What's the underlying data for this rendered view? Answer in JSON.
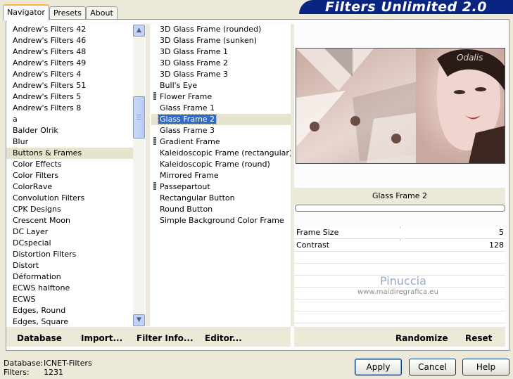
{
  "tabs": [
    "Navigator",
    "Presets",
    "About"
  ],
  "banner": "Filters Unlimited 2.0",
  "categories": [
    "Andrew's Filters 42",
    "Andrew's Filters 46",
    "Andrew's Filters 48",
    "Andrew's Filters 49",
    "Andrew's Filters 4",
    "Andrew's Filters 51",
    "Andrew's Filters 5",
    "Andrew's Filters 8",
    "a",
    "Balder Olrik",
    "Blur",
    "Buttons & Frames",
    "Color Effects",
    "Color Filters",
    "ColorRave",
    "Convolution Filters",
    "CPK Designs",
    "Crescent Moon",
    "DC Layer",
    "DCspecial",
    "Distortion Filters",
    "Distort",
    "Déformation",
    "ECWS halftone",
    "ECWS",
    "Edges, Round",
    "Edges, Square"
  ],
  "selected_category": "Buttons & Frames",
  "filters": [
    {
      "name": "3D Glass Frame (rounded)",
      "marked": false
    },
    {
      "name": "3D Glass Frame (sunken)",
      "marked": false
    },
    {
      "name": "3D Glass Frame 1",
      "marked": false
    },
    {
      "name": "3D Glass Frame 2",
      "marked": false
    },
    {
      "name": "3D Glass Frame 3",
      "marked": false
    },
    {
      "name": "Bull's Eye",
      "marked": false
    },
    {
      "name": "Flower Frame",
      "marked": true
    },
    {
      "name": "Glass Frame 1",
      "marked": false
    },
    {
      "name": "Glass Frame 2",
      "marked": false
    },
    {
      "name": "Glass Frame 3",
      "marked": false
    },
    {
      "name": "Gradient Frame",
      "marked": true
    },
    {
      "name": "Kaleidoscopic Frame (rectangular)",
      "marked": false
    },
    {
      "name": "Kaleidoscopic Frame (round)",
      "marked": false
    },
    {
      "name": "Mirrored Frame",
      "marked": false
    },
    {
      "name": "Passepartout",
      "marked": true
    },
    {
      "name": "Rectangular Button",
      "marked": false
    },
    {
      "name": "Round Button",
      "marked": false
    },
    {
      "name": "Simple Background Color Frame",
      "marked": false
    }
  ],
  "selected_filter": "Glass Frame 2",
  "preview": {
    "watermark_text": "Odalis"
  },
  "filter_name_display": "Glass Frame 2",
  "params": [
    {
      "label": "Frame Size",
      "value": "5"
    },
    {
      "label": "Contrast",
      "value": "128"
    }
  ],
  "watermark": {
    "title": "Pinuccia",
    "url": "www.maidiregrafica.eu"
  },
  "bottom_buttons": {
    "database": "Database",
    "import": "Import...",
    "filter_info": "Filter Info...",
    "editor": "Editor...",
    "randomize": "Randomize",
    "reset": "Reset"
  },
  "status": {
    "database_label": "Database:",
    "database_value": "ICNET-Filters",
    "filters_label": "Filters:",
    "filters_value": "1231"
  },
  "dialog_buttons": {
    "apply": "Apply",
    "cancel": "Cancel",
    "help": "Help"
  }
}
